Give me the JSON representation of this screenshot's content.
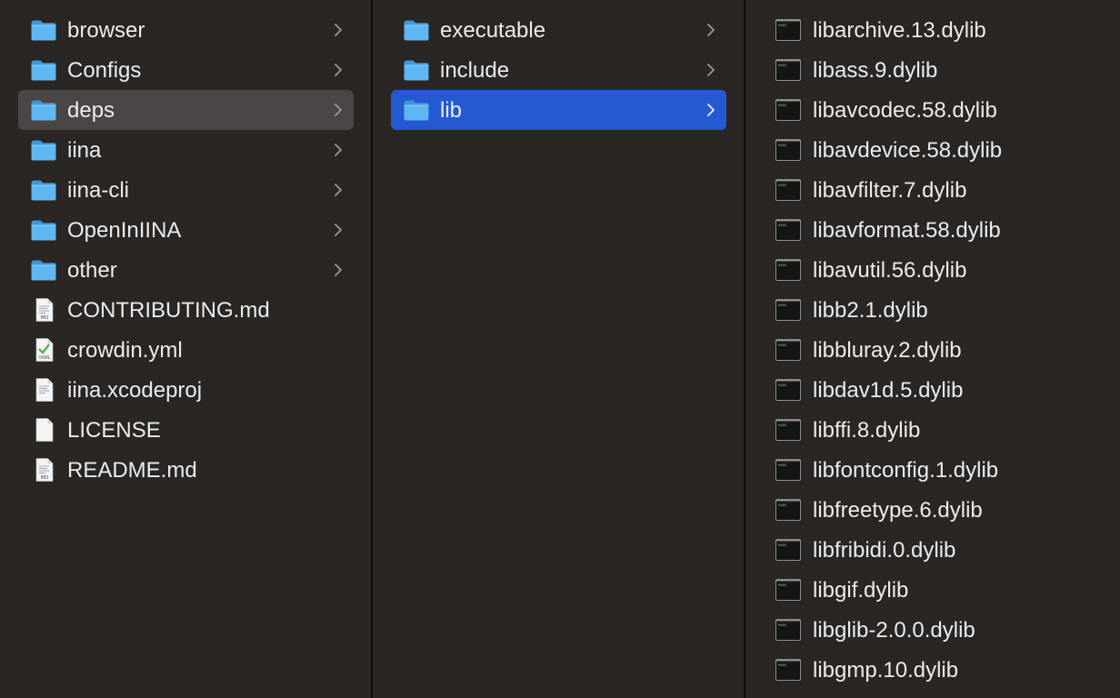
{
  "columns": [
    {
      "items": [
        {
          "name": "browser",
          "kind": "folder",
          "chevron": true,
          "selected": ""
        },
        {
          "name": "Configs",
          "kind": "folder",
          "chevron": true,
          "selected": ""
        },
        {
          "name": "deps",
          "kind": "folder",
          "chevron": true,
          "selected": "grey"
        },
        {
          "name": "iina",
          "kind": "folder",
          "chevron": true,
          "selected": ""
        },
        {
          "name": "iina-cli",
          "kind": "folder",
          "chevron": true,
          "selected": ""
        },
        {
          "name": "OpenInIINA",
          "kind": "folder",
          "chevron": true,
          "selected": ""
        },
        {
          "name": "other",
          "kind": "folder",
          "chevron": true,
          "selected": ""
        },
        {
          "name": "CONTRIBUTING.md",
          "kind": "md",
          "badge": "MD",
          "chevron": false,
          "selected": ""
        },
        {
          "name": "crowdin.yml",
          "kind": "yaml",
          "badge": "YAML",
          "chevron": false,
          "selected": ""
        },
        {
          "name": "iina.xcodeproj",
          "kind": "doc",
          "chevron": false,
          "selected": ""
        },
        {
          "name": "LICENSE",
          "kind": "blank",
          "chevron": false,
          "selected": ""
        },
        {
          "name": "README.md",
          "kind": "md",
          "badge": "MD",
          "chevron": false,
          "selected": ""
        }
      ]
    },
    {
      "items": [
        {
          "name": "executable",
          "kind": "folder",
          "chevron": true,
          "selected": ""
        },
        {
          "name": "include",
          "kind": "folder",
          "chevron": true,
          "selected": ""
        },
        {
          "name": "lib",
          "kind": "folder",
          "chevron": true,
          "selected": "blue"
        }
      ]
    },
    {
      "items": [
        {
          "name": "libarchive.13.dylib",
          "kind": "exec",
          "chevron": false,
          "selected": ""
        },
        {
          "name": "libass.9.dylib",
          "kind": "exec",
          "chevron": false,
          "selected": ""
        },
        {
          "name": "libavcodec.58.dylib",
          "kind": "exec",
          "chevron": false,
          "selected": ""
        },
        {
          "name": "libavdevice.58.dylib",
          "kind": "exec",
          "chevron": false,
          "selected": ""
        },
        {
          "name": "libavfilter.7.dylib",
          "kind": "exec",
          "chevron": false,
          "selected": ""
        },
        {
          "name": "libavformat.58.dylib",
          "kind": "exec",
          "chevron": false,
          "selected": ""
        },
        {
          "name": "libavutil.56.dylib",
          "kind": "exec",
          "chevron": false,
          "selected": ""
        },
        {
          "name": "libb2.1.dylib",
          "kind": "exec",
          "chevron": false,
          "selected": ""
        },
        {
          "name": "libbluray.2.dylib",
          "kind": "exec",
          "chevron": false,
          "selected": ""
        },
        {
          "name": "libdav1d.5.dylib",
          "kind": "exec",
          "chevron": false,
          "selected": ""
        },
        {
          "name": "libffi.8.dylib",
          "kind": "exec",
          "chevron": false,
          "selected": ""
        },
        {
          "name": "libfontconfig.1.dylib",
          "kind": "exec",
          "chevron": false,
          "selected": ""
        },
        {
          "name": "libfreetype.6.dylib",
          "kind": "exec",
          "chevron": false,
          "selected": ""
        },
        {
          "name": "libfribidi.0.dylib",
          "kind": "exec",
          "chevron": false,
          "selected": ""
        },
        {
          "name": "libgif.dylib",
          "kind": "exec",
          "chevron": false,
          "selected": ""
        },
        {
          "name": "libglib-2.0.0.dylib",
          "kind": "exec",
          "chevron": false,
          "selected": ""
        },
        {
          "name": "libgmp.10.dylib",
          "kind": "exec",
          "chevron": false,
          "selected": ""
        }
      ]
    }
  ],
  "colors": {
    "background": "#2a2624",
    "divider": "#0d0c0c",
    "selection_inactive": "#4a4645",
    "selection_active": "#2559d2",
    "folder_blue": "#5eb6f2",
    "text": "#ececec",
    "chevron": "#9b9897"
  }
}
